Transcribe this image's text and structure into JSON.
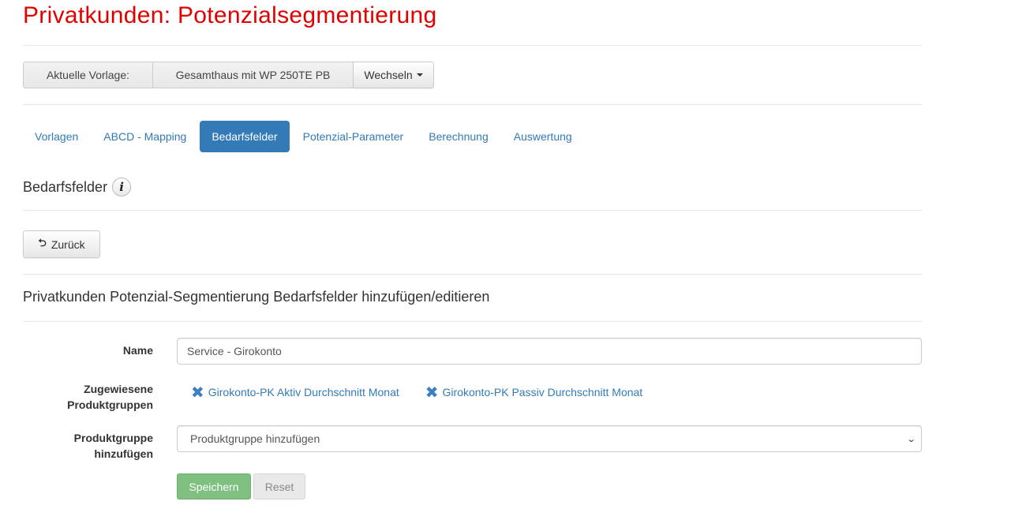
{
  "page": {
    "title": "Privatkunden: Potenzialsegmentierung"
  },
  "template_bar": {
    "label": "Aktuelle Vorlage:",
    "value": "Gesamthaus mit WP 250TE PB",
    "switch_label": "Wechseln"
  },
  "nav": {
    "items": [
      {
        "label": "Vorlagen",
        "active": false
      },
      {
        "label": "ABCD - Mapping",
        "active": false
      },
      {
        "label": "Bedarfsfelder",
        "active": true
      },
      {
        "label": "Potenzial-Parameter",
        "active": false
      },
      {
        "label": "Berechnung",
        "active": false
      },
      {
        "label": "Auswertung",
        "active": false
      }
    ]
  },
  "section": {
    "title": "Bedarfsfelder",
    "info_icon": "info-icon"
  },
  "back_button": {
    "label": "Zurück",
    "icon": "return-arrow-icon"
  },
  "form": {
    "heading": "Privatkunden Potenzial-Segmentierung Bedarfsfelder hinzufügen/editieren",
    "name_label": "Name",
    "name_value": "Service - Girokonto",
    "assigned_label_line1": "Zugewiesene",
    "assigned_label_line2": "Produktgruppen",
    "assigned_groups": [
      "Girokonto-PK Aktiv Durchschnitt Monat",
      "Girokonto-PK Passiv Durchschnitt Monat"
    ],
    "add_label_line1": "Produktgruppe",
    "add_label_line2": "hinzufügen",
    "add_select_value": "Produktgruppe hinzufügen",
    "save_label": "Speichern",
    "reset_label": "Reset"
  },
  "colors": {
    "title_red": "#e10000",
    "link_blue": "#337ab7",
    "save_green": "#7fc080"
  }
}
